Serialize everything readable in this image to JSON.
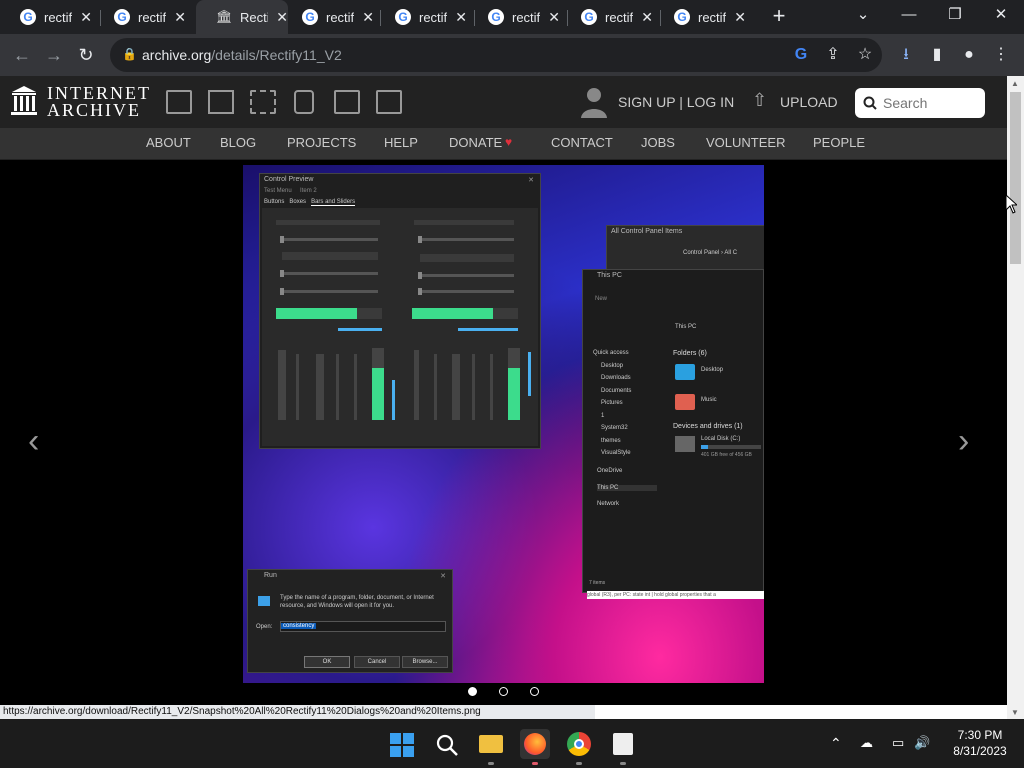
{
  "browser": {
    "tabs": [
      {
        "title": "rectify",
        "close": "✕"
      },
      {
        "title": "rectify",
        "close": "✕"
      },
      {
        "title": "Rectif",
        "close": "✕",
        "active": true
      },
      {
        "title": "rectify",
        "close": "✕"
      },
      {
        "title": "rectify",
        "close": "✕"
      },
      {
        "title": "rectify",
        "close": "✕"
      },
      {
        "title": "rectify",
        "close": "✕"
      },
      {
        "title": "rectify",
        "close": "✕"
      }
    ],
    "new_tab": "+",
    "url_host": "archive.org",
    "url_path": "/details/Rectify11_V2"
  },
  "ia": {
    "logo_line1": "INTERNET",
    "logo_line2": "ARCHIVE",
    "signup_login": "SIGN UP | LOG IN",
    "upload": "UPLOAD",
    "search_placeholder": "Search",
    "nav": [
      "ABOUT",
      "BLOG",
      "PROJECTS",
      "HELP",
      "DONATE",
      "CONTACT",
      "JOBS",
      "VOLUNTEER",
      "PEOPLE"
    ]
  },
  "screenshot": {
    "control_preview": {
      "title": "Control Preview",
      "menu": [
        "Test Menu",
        "Item 2"
      ],
      "tabs": [
        "Buttons",
        "Boxes",
        "Bars and Sliders"
      ],
      "progress_fill_left": 0.76,
      "progress_fill_right": 0.76
    },
    "control_panel": {
      "title": "All Control Panel Items",
      "breadcrumb": "Control Panel  ›  All C"
    },
    "explorer": {
      "title": "This PC",
      "new": "New",
      "breadcrumb": "This PC",
      "sidebar": [
        "Quick access",
        "Desktop",
        "Downloads",
        "Documents",
        "Pictures",
        "1",
        "System32",
        "themes",
        "VisualStyle",
        "OneDrive",
        "This PC",
        "Network"
      ],
      "folders_header": "Folders (6)",
      "folders": [
        "Desktop",
        "Music"
      ],
      "drives_header": "Devices and drives (1)",
      "drive_name": "Local Disk (C:)",
      "drive_free": "401 GB free of 456 GB",
      "drive_used_fraction": 0.12,
      "status": "7 items",
      "status2": "global (R3), per PC: state int | hold global properties that a"
    },
    "run": {
      "title": "Run",
      "desc": "Type the name of a program, folder, document, or Internet resource, and Windows will open it for you.",
      "open_label": "Open:",
      "value": "consistency",
      "ok": "OK",
      "cancel": "Cancel",
      "browse": "Browse..."
    }
  },
  "status_url": "https://archive.org/download/Rectify11_V2/Snapshot%20All%20Rectify11%20Dialogs%20and%20Items.png",
  "taskbar": {
    "time": "7:30 PM",
    "date": "8/31/2023"
  },
  "colors": {
    "accent_green": "#3cdc8c",
    "donate_heart": "#e0303c",
    "chrome_dark": "#202124"
  }
}
